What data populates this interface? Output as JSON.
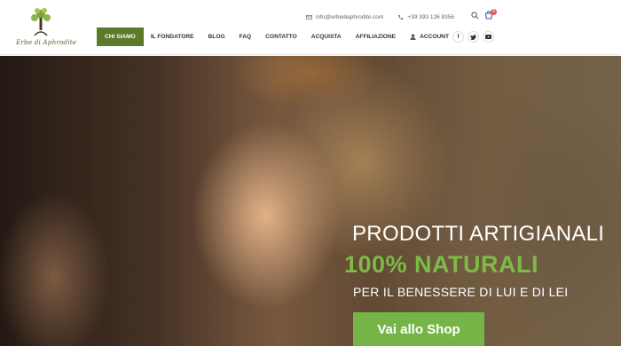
{
  "brand": {
    "logo_text": "Erbe di Aphrodite",
    "green": "#5b7a2a"
  },
  "topbar": {
    "email": "info@erbediaphrodite.com",
    "phone": "+39 393 126 8356",
    "cart_count": "0"
  },
  "nav": {
    "items": [
      "Chi Siamo",
      "Il Fondatore",
      "Blog",
      "FAQ",
      "Contatto",
      "Acquista",
      "Affiliazione",
      "Account"
    ],
    "active": "Chi Siamo"
  },
  "socials": [
    "f",
    "t",
    "▶"
  ],
  "hero": {
    "line1": "PRODOTTI ARTIGIANALI",
    "line2": "100% NATURALI",
    "line3": "PER IL BENESSERE DI LUI E DI LEI",
    "button_label": "Vai allo Shop",
    "accent": "#75b548"
  }
}
